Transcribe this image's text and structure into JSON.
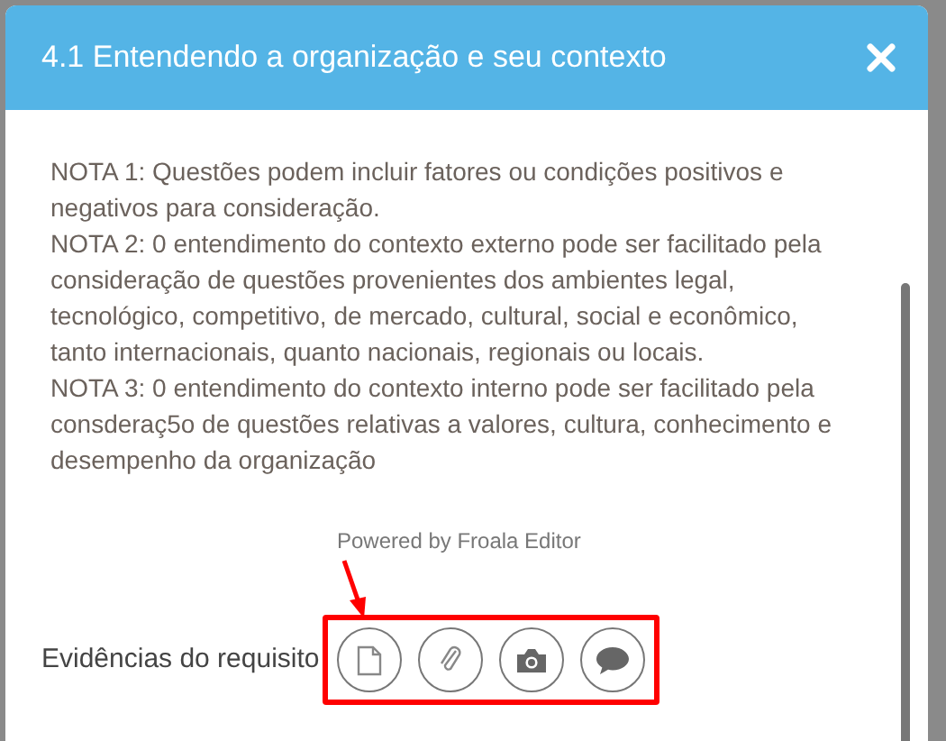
{
  "dialog": {
    "title": "4.1 Entendendo a organização e seu contexto"
  },
  "notes": [
    "NOTA 1: Questões podem incluir fatores ou condições positivos e negativos para consideração.",
    "NOTA 2: 0 entendimento do contexto externo pode ser facilitado pela consideração de questões provenientes dos ambientes legal, tecnológico, competitivo, de mercado, cultural, social e econômico, tanto internacionais, quanto nacionais, regionais ou locais.",
    "NOTA 3: 0 entendimento do contexto interno pode ser facilitado pela consderaç5o de questões relativas a valores, cultura, conhecimento e desempenho da organização"
  ],
  "editor_credit": "Powered by Froala Editor",
  "evidence": {
    "label": "Evidências do requisito",
    "highlighted": true,
    "buttons": [
      {
        "kind": "document"
      },
      {
        "kind": "attachment"
      },
      {
        "kind": "camera"
      },
      {
        "kind": "comment"
      }
    ]
  }
}
